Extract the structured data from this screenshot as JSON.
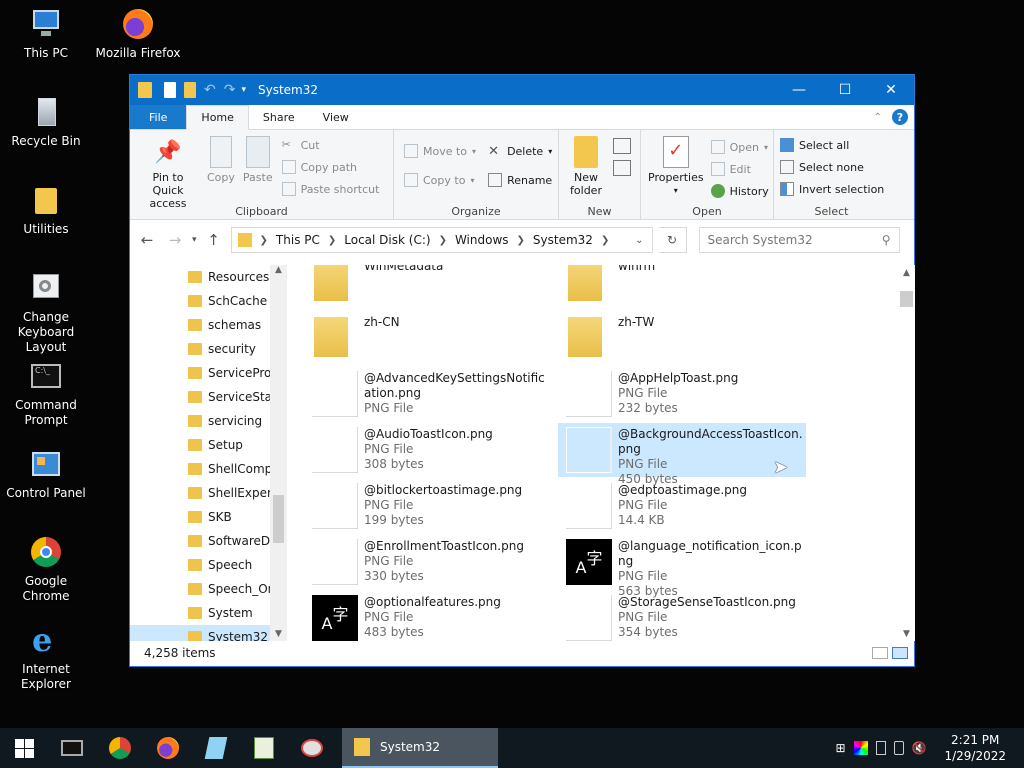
{
  "desktop": {
    "icons": [
      {
        "label": "This PC",
        "icon": "this-pc-icon"
      },
      {
        "label": "Mozilla Firefox",
        "icon": "firefox-icon"
      },
      {
        "label": "Recycle Bin",
        "icon": "recycle-bin-icon"
      },
      {
        "label": "Utilities",
        "icon": "folder-icon"
      },
      {
        "label": "Change Keyboard Layout",
        "icon": "keyboard-settings-icon"
      },
      {
        "label": "Command Prompt",
        "icon": "command-prompt-icon"
      },
      {
        "label": "Control Panel",
        "icon": "control-panel-icon"
      },
      {
        "label": "Google Chrome",
        "icon": "chrome-icon"
      },
      {
        "label": "Internet Explorer",
        "icon": "internet-explorer-icon"
      }
    ]
  },
  "window": {
    "title": "System32"
  },
  "tabs": {
    "file": "File",
    "home": "Home",
    "share": "Share",
    "view": "View"
  },
  "ribbon": {
    "clipboard": {
      "label": "Clipboard",
      "pin": "Pin to Quick access",
      "copy": "Copy",
      "paste": "Paste",
      "cut": "Cut",
      "copy_path": "Copy path",
      "paste_shortcut": "Paste shortcut"
    },
    "organize": {
      "label": "Organize",
      "move_to": "Move to",
      "copy_to": "Copy to",
      "delete": "Delete",
      "rename": "Rename"
    },
    "new": {
      "label": "New",
      "new_folder": "New folder"
    },
    "open": {
      "label": "Open",
      "properties": "Properties",
      "open": "Open",
      "edit": "Edit",
      "history": "History"
    },
    "select": {
      "label": "Select",
      "select_all": "Select all",
      "select_none": "Select none",
      "invert": "Invert selection"
    }
  },
  "address": {
    "crumbs": [
      "This PC",
      "Local Disk (C:)",
      "Windows",
      "System32"
    ],
    "search_placeholder": "Search System32"
  },
  "nav": {
    "items": [
      "Resources",
      "SchCache",
      "schemas",
      "security",
      "ServiceProfi",
      "ServiceState",
      "servicing",
      "Setup",
      "ShellCompo",
      "ShellExperie",
      "SKB",
      "SoftwareDis",
      "Speech",
      "Speech_One",
      "System",
      "System32"
    ],
    "selected": "System32"
  },
  "files": [
    {
      "name": "WinMetadata",
      "type": "",
      "size": "",
      "kind": "folder"
    },
    {
      "name": "winrm",
      "type": "",
      "size": "",
      "kind": "folder"
    },
    {
      "name": "zh-CN",
      "type": "",
      "size": "",
      "kind": "folder"
    },
    {
      "name": "zh-TW",
      "type": "",
      "size": "",
      "kind": "folder"
    },
    {
      "name": "@AdvancedKeySettingsNotification.png",
      "type": "PNG File",
      "size": "",
      "kind": "blank"
    },
    {
      "name": "@AppHelpToast.png",
      "type": "PNG File",
      "size": "232 bytes",
      "kind": "blank"
    },
    {
      "name": "@AudioToastIcon.png",
      "type": "PNG File",
      "size": "308 bytes",
      "kind": "blank"
    },
    {
      "name": "@BackgroundAccessToastIcon.png",
      "type": "PNG File",
      "size": "450 bytes",
      "kind": "access"
    },
    {
      "name": "@bitlockertoastimage.png",
      "type": "PNG File",
      "size": "199 bytes",
      "kind": "blank"
    },
    {
      "name": "@edptoastimage.png",
      "type": "PNG File",
      "size": "14.4 KB",
      "kind": "blank"
    },
    {
      "name": "@EnrollmentToastIcon.png",
      "type": "PNG File",
      "size": "330 bytes",
      "kind": "blank"
    },
    {
      "name": "@language_notification_icon.png",
      "type": "PNG File",
      "size": "563 bytes",
      "kind": "lang"
    },
    {
      "name": "@optionalfeatures.png",
      "type": "PNG File",
      "size": "483 bytes",
      "kind": "lang"
    },
    {
      "name": "@StorageSenseToastIcon.png",
      "type": "PNG File",
      "size": "354 bytes",
      "kind": "blank"
    }
  ],
  "lang_glyph": {
    "a": "A",
    "zi": "字"
  },
  "status": {
    "count": "4,258 items"
  },
  "taskbar": {
    "active_label": "System32",
    "time": "2:21 PM",
    "date": "1/29/2022"
  }
}
